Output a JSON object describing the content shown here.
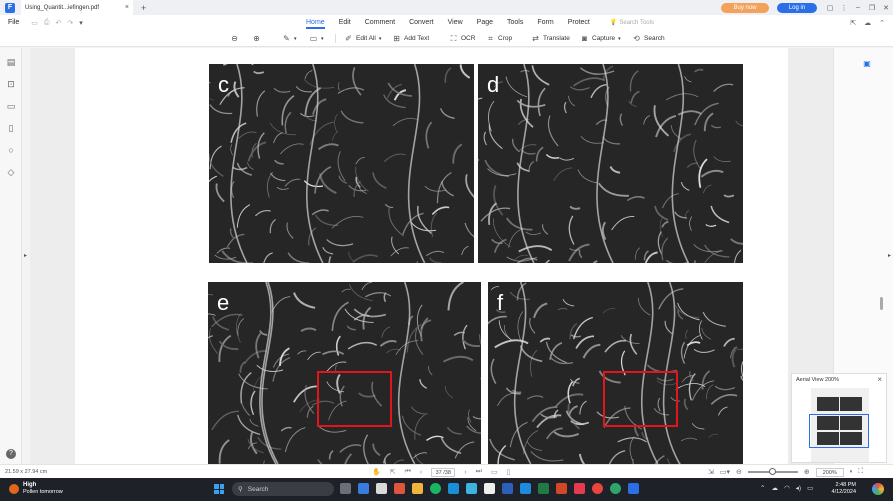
{
  "titlebar": {
    "tab_title": "Using_Quantit...iefingen.pdf",
    "tab_close": "×",
    "new_tab": "+",
    "buy_now": "Buy now",
    "log_in": "Log in"
  },
  "menubar": {
    "file": "File",
    "items": [
      {
        "label": "Home",
        "active": true
      },
      {
        "label": "Edit"
      },
      {
        "label": "Comment"
      },
      {
        "label": "Convert"
      },
      {
        "label": "View"
      },
      {
        "label": "Page"
      },
      {
        "label": "Tools"
      },
      {
        "label": "Form"
      },
      {
        "label": "Protect"
      }
    ],
    "search_tools": "Search Tools"
  },
  "toolbar": {
    "edit_all": "Edit All",
    "add_text": "Add Text",
    "ocr": "OCR",
    "crop": "Crop",
    "translate": "Translate",
    "capture": "Capture",
    "search": "Search"
  },
  "document": {
    "panels": [
      {
        "label": "c"
      },
      {
        "label": "d"
      },
      {
        "label": "e"
      },
      {
        "label": "f"
      }
    ]
  },
  "aerial_view": {
    "title": "Aerial View  200%",
    "close": "×"
  },
  "statusbar": {
    "page_size": "21.59 x 27.94 cm",
    "page_number": "37 /38",
    "zoom": "200%",
    "zoom_fraction": 0.5
  },
  "taskbar": {
    "weather_title": "High",
    "weather_sub": "Pollen tomorrow",
    "search_placeholder": "Search",
    "time": "2:48 PM",
    "date": "4/12/2024"
  },
  "colors": {
    "accent": "#2a6ee8",
    "buy_now": "#f2a25a",
    "roi_box": "#e0161b"
  }
}
